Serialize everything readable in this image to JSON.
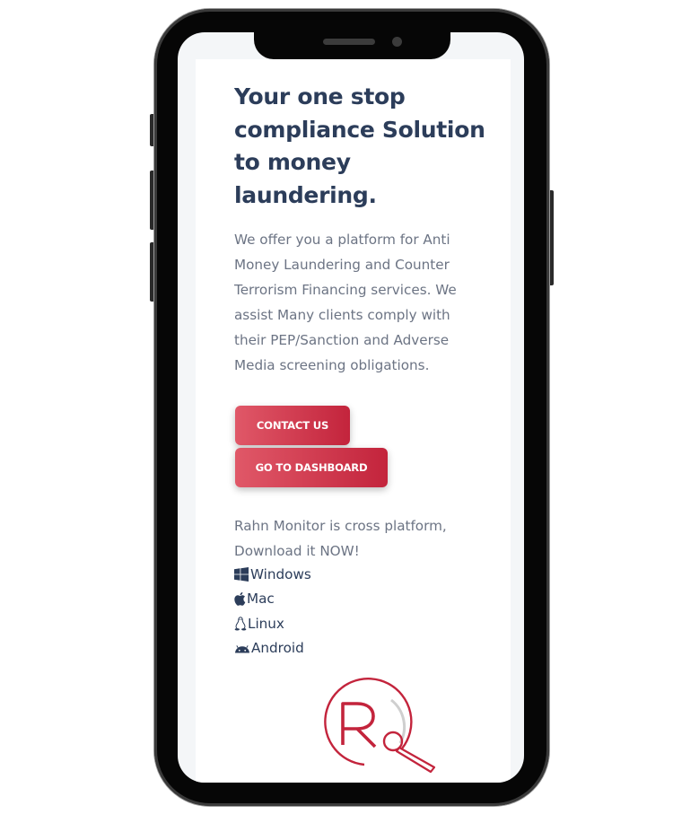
{
  "hero": {
    "title": "Your one stop compliance Solution to money laundering.",
    "description": "We offer you a platform for Anti Money Laundering and Counter Terrorism Financing services. We assist Many clients comply with their PEP/Sanction and Adverse Media screening obligations."
  },
  "buttons": {
    "contact_label": "CONTACT US",
    "dashboard_label": "GO TO DASHBOARD"
  },
  "platforms": {
    "intro": "Rahn Monitor is cross platform, Download it NOW!",
    "items": [
      {
        "label": "Windows",
        "icon": "windows-icon"
      },
      {
        "label": "Mac",
        "icon": "apple-icon"
      },
      {
        "label": "Linux",
        "icon": "linux-icon"
      },
      {
        "label": "Android",
        "icon": "android-icon"
      }
    ]
  },
  "colors": {
    "heading": "#2c3d5a",
    "body_text": "#6c7484",
    "button_gradient_start": "#e05868",
    "button_gradient_end": "#c3243c",
    "logo_red": "#c3243c"
  }
}
